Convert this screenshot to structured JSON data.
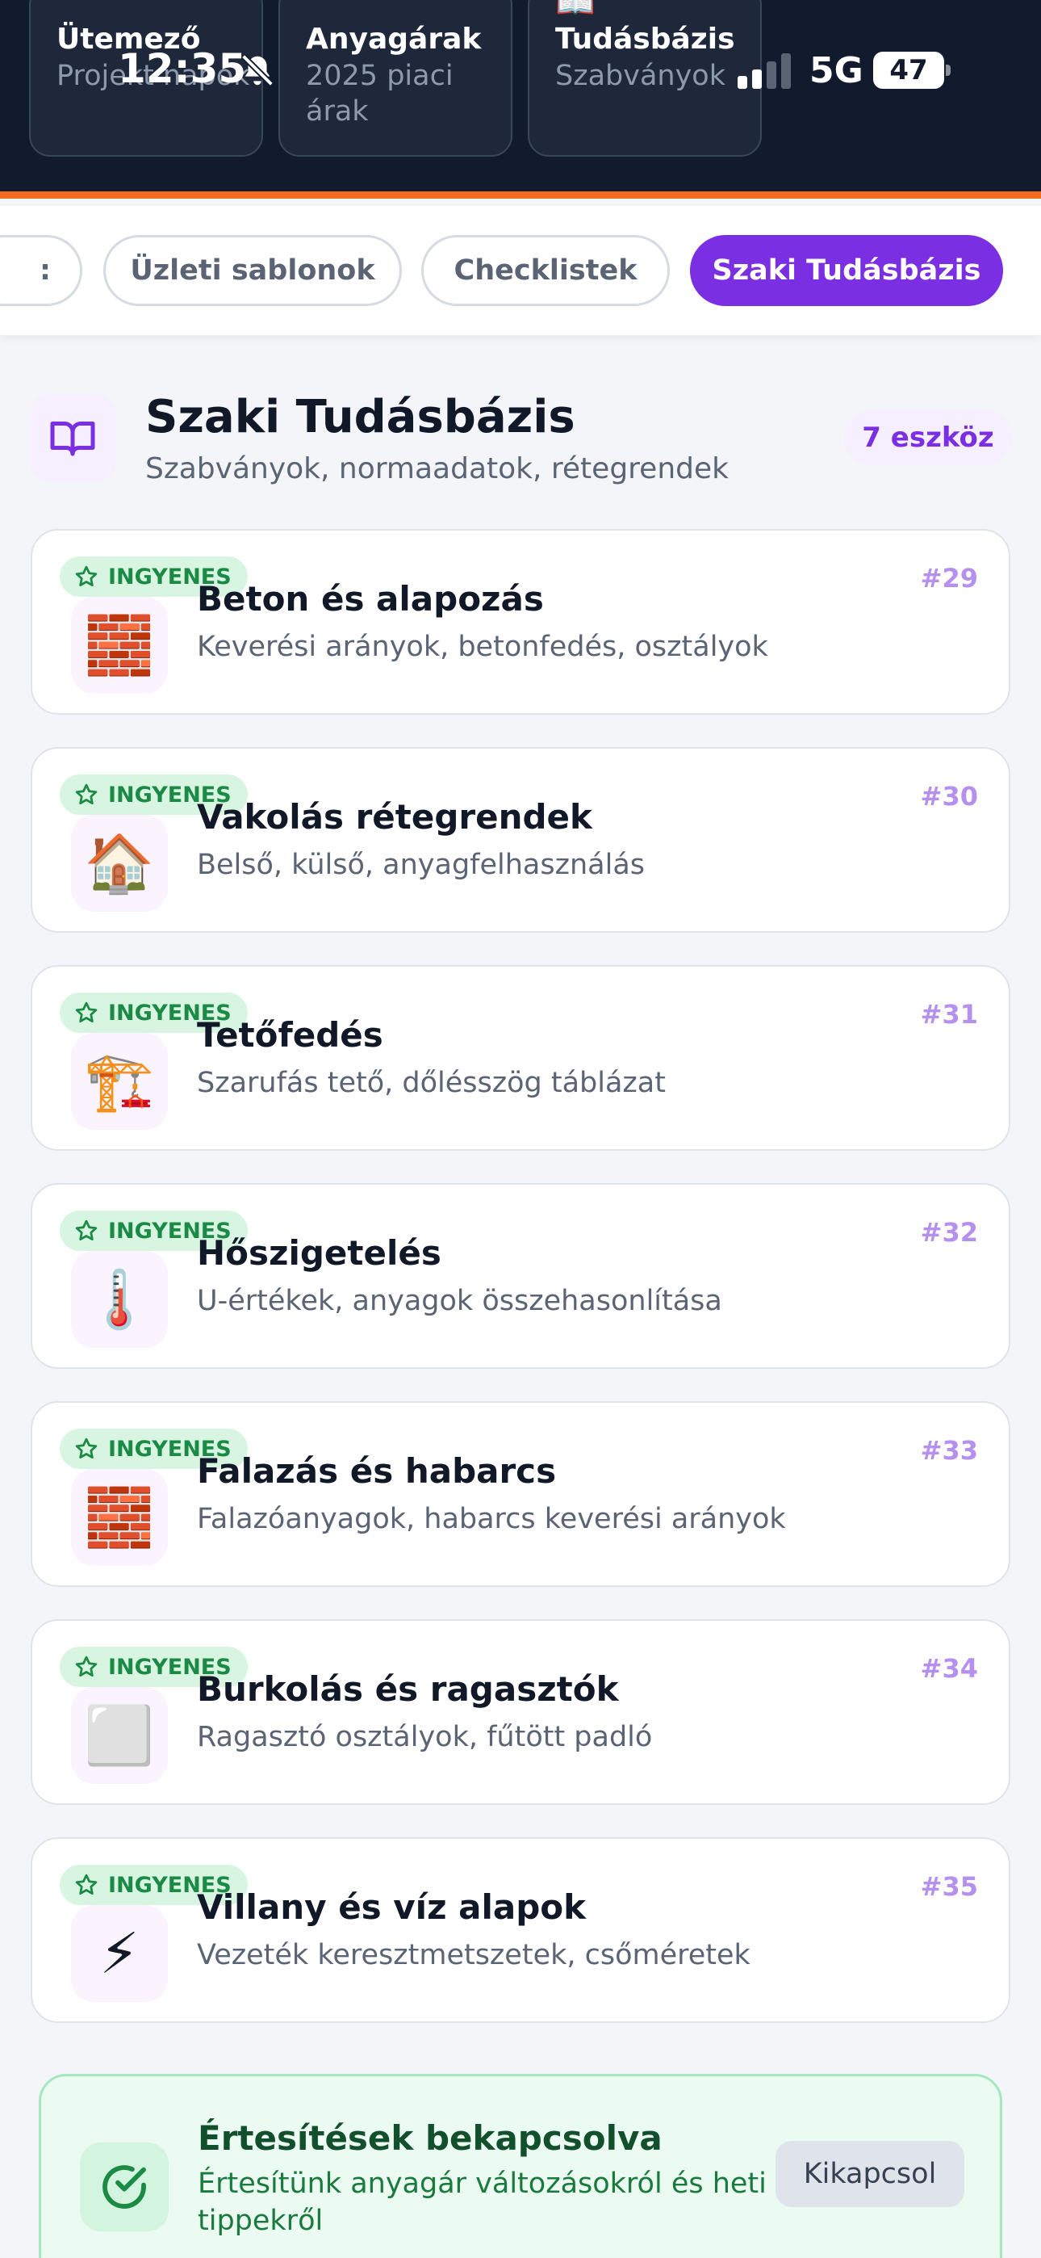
{
  "status_bar": {
    "time": "12:35",
    "network": "5G",
    "battery": "47"
  },
  "top_cards": [
    {
      "title": "Ütemező",
      "subtitle": "Projekt napok"
    },
    {
      "title": "Anyagárak",
      "subtitle": "2025 piaci árak"
    },
    {
      "title": "Tudásbázis",
      "subtitle": "Szabványok"
    }
  ],
  "tabs": [
    {
      "label": ":"
    },
    {
      "label": "Üzleti sablonok"
    },
    {
      "label": "Checklistek"
    },
    {
      "label": "Szaki Tudásbázis",
      "active": true
    }
  ],
  "section": {
    "title": "Szaki Tudásbázis",
    "subtitle": "Szabványok, normaadatok, rétegrendek",
    "badge": "7 eszköz",
    "icon": "book-open-icon"
  },
  "free_label": "INGYENES",
  "tools": [
    {
      "number": "#29",
      "title": "Beton és alapozás",
      "subtitle": "Keverési arányok, betonfedés, osztályok",
      "icon": "🧱"
    },
    {
      "number": "#30",
      "title": "Vakolás rétegrendek",
      "subtitle": "Belső, külső, anyagfelhasználás",
      "icon": "🏠"
    },
    {
      "number": "#31",
      "title": "Tetőfedés",
      "subtitle": "Szarufás tető, dőlésszög táblázat",
      "icon": "🏗️"
    },
    {
      "number": "#32",
      "title": "Hőszigetelés",
      "subtitle": "U-értékek, anyagok összehasonlítása",
      "icon": "🌡️"
    },
    {
      "number": "#33",
      "title": "Falazás és habarcs",
      "subtitle": "Falazóanyagok, habarcs keverési arányok",
      "icon": "🧱"
    },
    {
      "number": "#34",
      "title": "Burkolás és ragasztók",
      "subtitle": "Ragasztó osztályok, fűtött padló",
      "icon": "⬜"
    },
    {
      "number": "#35",
      "title": "Villany és víz alapok",
      "subtitle": "Vezeték keresztmetszetek, csőméretek",
      "icon": "⚡"
    }
  ],
  "notification": {
    "title": "Értesítések bekapcsolva",
    "text": "Értesítünk anyagár változásokról és heti tippekről",
    "button": "Kikapcsol"
  },
  "colors": {
    "header_bg": "#121b2e",
    "accent_orange": "#f26a1b",
    "accent_purple": "#7b2fe3",
    "free_green": "#1b8a45"
  }
}
